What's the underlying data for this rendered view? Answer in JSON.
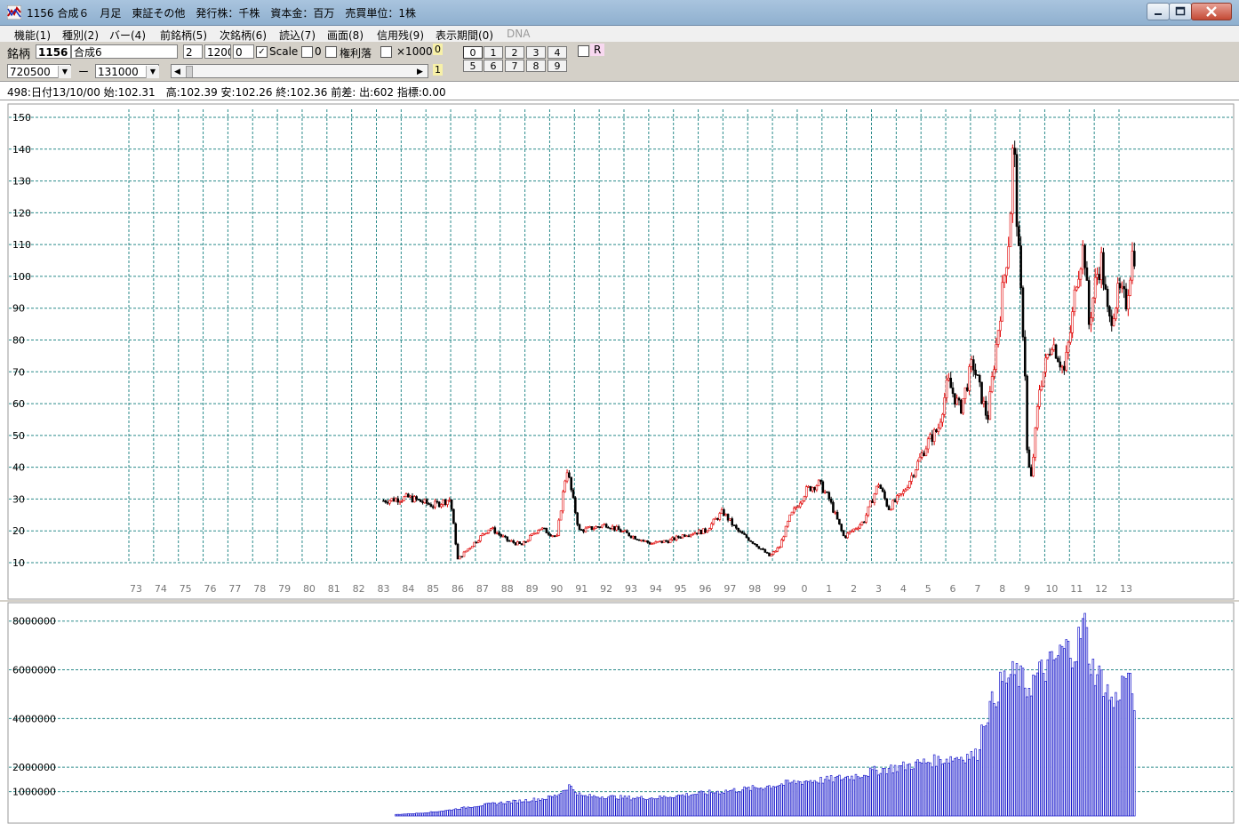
{
  "window": {
    "title": "1156 合成６　月足　東証その他　発行株：千株　資本金：百万　売買単位：1株"
  },
  "menu": [
    {
      "label": "機能(1)",
      "disabled": false
    },
    {
      "label": "種別(2)",
      "disabled": false
    },
    {
      "label": "バー(4)",
      "disabled": false
    },
    {
      "label": "前銘柄(5)",
      "disabled": false
    },
    {
      "label": "次銘柄(6)",
      "disabled": false
    },
    {
      "label": "読込(7)",
      "disabled": false
    },
    {
      "label": "画面(8)",
      "disabled": false
    },
    {
      "label": "信用残(9)",
      "disabled": false
    },
    {
      "label": "表示期間(0)",
      "disabled": false
    },
    {
      "label": "DNA",
      "disabled": true
    }
  ],
  "toolbar": {
    "symbol_label": "銘柄",
    "symbol_code": "1156",
    "symbol_name": "合成6",
    "field_a": "2",
    "field_b": "1200",
    "field_c": "0",
    "scale_label": "Scale",
    "zero_label": "0",
    "rights_label": "権利落",
    "x1000_label": "×1000",
    "badge_0": "0",
    "badge_1": "1",
    "from_value": "720500",
    "dash": "ー",
    "to_value": "131000",
    "r_label": "R",
    "digits_row1": [
      "0",
      "1",
      "2",
      "3",
      "4"
    ],
    "digits_row2": [
      "5",
      "6",
      "7",
      "8",
      "9"
    ]
  },
  "info": {
    "text": "498:日付13/10/00 始:102.31　高:102.39 安:102.26 終:102.36 前差:  出:602 指標:0.00"
  },
  "colors": {
    "up": "#e00000",
    "down": "#000000",
    "volume": "#1a1acc",
    "grid": "#2a8a8a"
  },
  "chart_data": [
    {
      "type": "candlestick",
      "ylim": [
        10,
        150
      ],
      "y_ticks": [
        "150",
        "140",
        "130",
        "120",
        "110",
        "100",
        "90",
        "80",
        "70",
        "60",
        "50",
        "40",
        "30",
        "20",
        "10"
      ],
      "x_ticks": [
        "73",
        "74",
        "75",
        "76",
        "77",
        "78",
        "79",
        "80",
        "81",
        "82",
        "83",
        "84",
        "85",
        "86",
        "87",
        "88",
        "89",
        "90",
        "91",
        "92",
        "93",
        "94",
        "95",
        "96",
        "97",
        "98",
        "99",
        "0",
        "1",
        "2",
        "3",
        "4",
        "5",
        "6",
        "7",
        "8",
        "9",
        "10",
        "11",
        "12",
        "13"
      ],
      "series_points": [
        [
          1983.0,
          29.5
        ],
        [
          1984.0,
          30.5
        ],
        [
          1985.0,
          28
        ],
        [
          1985.7,
          30
        ],
        [
          1986.0,
          11
        ],
        [
          1986.5,
          15
        ],
        [
          1987.3,
          21
        ],
        [
          1988.0,
          17
        ],
        [
          1988.6,
          15.5
        ],
        [
          1989.3,
          21
        ],
        [
          1990.0,
          18
        ],
        [
          1990.4,
          40
        ],
        [
          1990.9,
          20
        ],
        [
          1991.5,
          21
        ],
        [
          1992.0,
          22
        ],
        [
          1993.0,
          18.5
        ],
        [
          1993.8,
          16
        ],
        [
          1994.6,
          17
        ],
        [
          1995.2,
          19
        ],
        [
          1996.0,
          20
        ],
        [
          1996.7,
          26
        ],
        [
          1997.3,
          20
        ],
        [
          1998.0,
          16
        ],
        [
          1998.6,
          12
        ],
        [
          1999.0,
          15
        ],
        [
          1999.4,
          24
        ],
        [
          2000.1,
          33
        ],
        [
          2000.6,
          35
        ],
        [
          2001.0,
          30
        ],
        [
          2001.6,
          18
        ],
        [
          2002.4,
          23
        ],
        [
          2003.0,
          35
        ],
        [
          2003.4,
          27
        ],
        [
          2004.0,
          32
        ],
        [
          2004.5,
          40
        ],
        [
          2005.0,
          48
        ],
        [
          2005.4,
          52
        ],
        [
          2005.8,
          67
        ],
        [
          2006.3,
          58
        ],
        [
          2006.8,
          73
        ],
        [
          2007.4,
          55
        ],
        [
          2007.7,
          75
        ],
        [
          2008.0,
          95
        ],
        [
          2008.3,
          115
        ],
        [
          2008.45,
          145
        ],
        [
          2008.55,
          125
        ],
        [
          2008.7,
          100
        ],
        [
          2008.9,
          75
        ],
        [
          2009.0,
          45
        ],
        [
          2009.15,
          35
        ],
        [
          2009.5,
          65
        ],
        [
          2010.0,
          80
        ],
        [
          2010.5,
          70
        ],
        [
          2010.8,
          85
        ],
        [
          2011.0,
          100
        ],
        [
          2011.3,
          110
        ],
        [
          2011.5,
          85
        ],
        [
          2011.8,
          100
        ],
        [
          2012.0,
          105
        ],
        [
          2012.3,
          85
        ],
        [
          2012.7,
          95
        ],
        [
          2013.0,
          92
        ],
        [
          2013.3,
          110
        ],
        [
          2013.4,
          102
        ]
      ]
    },
    {
      "type": "bar",
      "ylim": [
        0,
        8500000
      ],
      "y_ticks": [
        "8000000",
        "6000000",
        "4000000",
        "2000000",
        "1000000"
      ],
      "series_points": [
        [
          1983.5,
          60000
        ],
        [
          1984.5,
          120000
        ],
        [
          1985.5,
          220000
        ],
        [
          1986.5,
          380000
        ],
        [
          1987.5,
          520000
        ],
        [
          1988.5,
          620000
        ],
        [
          1989.5,
          720000
        ],
        [
          1990.0,
          850000
        ],
        [
          1990.5,
          1250000
        ],
        [
          1991.0,
          820000
        ],
        [
          1992.0,
          800000
        ],
        [
          1993.0,
          750000
        ],
        [
          1994.0,
          750000
        ],
        [
          1995.0,
          850000
        ],
        [
          1996.0,
          950000
        ],
        [
          1997.0,
          1050000
        ],
        [
          1998.0,
          1150000
        ],
        [
          1999.0,
          1300000
        ],
        [
          2000.0,
          1450000
        ],
        [
          2001.0,
          1500000
        ],
        [
          2002.0,
          1650000
        ],
        [
          2003.0,
          1900000
        ],
        [
          2004.0,
          2050000
        ],
        [
          2005.0,
          2250000
        ],
        [
          2006.0,
          2400000
        ],
        [
          2007.0,
          2550000
        ],
        [
          2007.2,
          3800000
        ],
        [
          2007.6,
          4700000
        ],
        [
          2008.0,
          5600000
        ],
        [
          2008.6,
          5900000
        ],
        [
          2009.0,
          5300000
        ],
        [
          2009.5,
          5900000
        ],
        [
          2010.0,
          6300000
        ],
        [
          2010.5,
          6900000
        ],
        [
          2011.0,
          6900000
        ],
        [
          2011.3,
          8100000
        ],
        [
          2011.6,
          6200000
        ],
        [
          2012.0,
          5700000
        ],
        [
          2012.5,
          4600000
        ],
        [
          2013.0,
          5900000
        ],
        [
          2013.4,
          4600000
        ]
      ]
    }
  ]
}
